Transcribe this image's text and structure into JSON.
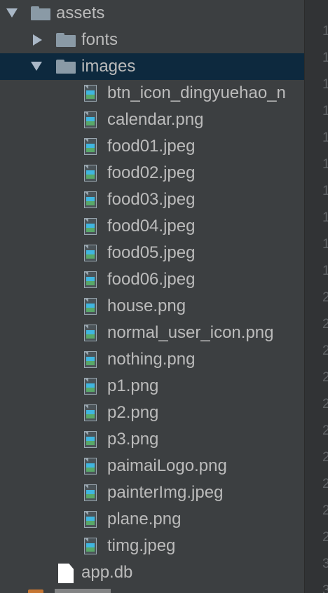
{
  "tree": {
    "assets": {
      "label": "assets"
    },
    "fonts": {
      "label": "fonts"
    },
    "images": {
      "label": "images"
    },
    "image_files": [
      "btn_icon_dingyuehao_n",
      "calendar.png",
      "food01.jpeg",
      "food02.jpeg",
      "food03.jpeg",
      "food04.jpeg",
      "food05.jpeg",
      "food06.jpeg",
      "house.png",
      "normal_user_icon.png",
      "nothing.png",
      "p1.png",
      "p2.png",
      "p3.png",
      "paimaiLogo.png",
      "painterImg.jpeg",
      "plane.png",
      "timg.jpeg"
    ],
    "app_db": {
      "label": "app.db"
    }
  },
  "gutter": {
    "line_numbers": [
      "1",
      "1",
      "1",
      "1",
      "1",
      "1",
      "1",
      "1",
      "1",
      "1",
      "2",
      "2",
      "2",
      "2",
      "2",
      "2",
      "2",
      "2",
      "2",
      "2",
      "3",
      "3"
    ]
  },
  "colors": {
    "panel_bg": "#3c3f41",
    "selected_row": "#0d293e",
    "text": "#bbbbbb",
    "folder": "#8a9aa6"
  },
  "icons": {
    "expanded_arrow": "chevron-down-icon",
    "collapsed_arrow": "chevron-right-icon",
    "folder": "folder-icon",
    "image_file": "image-file-icon",
    "db_file": "file-icon"
  }
}
